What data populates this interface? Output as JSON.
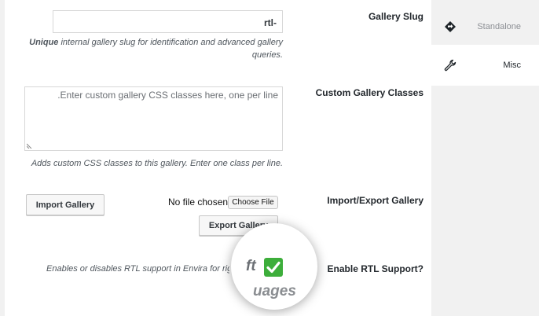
{
  "sidebar": {
    "tabs": [
      {
        "label": "Standalone",
        "icon": "diamond-arrow-icon",
        "active": false
      },
      {
        "label": "Misc",
        "icon": "wrench-icon",
        "active": true
      }
    ]
  },
  "fields": {
    "gallery_slug": {
      "label": "Gallery Slug",
      "value": "rtl-",
      "description_bold": "Unique",
      "description_line1": "internal gallery slug for identification and advanced gallery",
      "description_line2": ".queries"
    },
    "custom_classes": {
      "label": "Custom Gallery Classes",
      "placeholder": ".Enter custom gallery CSS classes here, one per line",
      "description": ".Adds custom CSS classes to this gallery. Enter one class per line"
    },
    "import_export": {
      "label": "Import/Export Gallery",
      "import_button": "Import Gallery",
      "file_status": "No file chosen",
      "choose_file_button": "Choose File",
      "export_button": "Export Gallery"
    },
    "rtl_support": {
      "label": "?Enable RTL Support",
      "description": "Enables or disables RTL support in Envira for right-to-left languages",
      "checked": true
    }
  },
  "magnifier": {
    "text_top": "ft",
    "text_bottom": "uages"
  },
  "colors": {
    "check_green": "#3dae3b",
    "panel_bg": "#ffffff",
    "page_bg": "#f1f1f1"
  }
}
